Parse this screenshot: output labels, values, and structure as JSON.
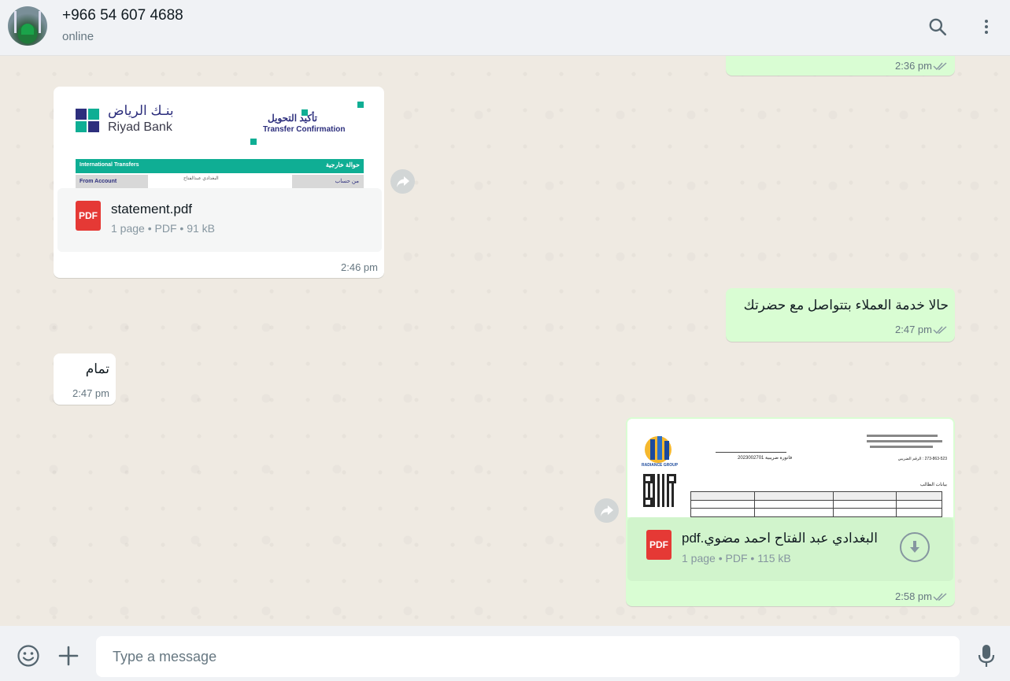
{
  "header": {
    "contact_name": "+966 54 607 4688",
    "status": "online",
    "icons": [
      "search-icon",
      "menu-dots-icon"
    ]
  },
  "messages": [
    {
      "id": "m0",
      "direction": "outgoing",
      "type": "partial",
      "time": "2:36 pm",
      "read": true
    },
    {
      "id": "m1",
      "direction": "incoming",
      "type": "document",
      "time": "2:46 pm",
      "file": {
        "name": "statement.pdf",
        "pages": "1 page",
        "kind": "PDF",
        "size": "91 kB"
      },
      "preview": {
        "bank_name_ar": "بنـك الرياض",
        "bank_name_en": "Riyad Bank",
        "title_ar": "تأكيد التحويل",
        "title_en": "Transfer Confirmation",
        "bar_left": "International Transfers",
        "bar_right": "حوالة خارجية",
        "row_left": "From Account",
        "row_mid": "البغدادي عبدالفتاح",
        "row_right": "من حساب"
      },
      "forward_icon": "forward-icon"
    },
    {
      "id": "m2",
      "direction": "outgoing",
      "type": "text",
      "text": "حالا خدمة العملاء بتتواصل مع حضرتك",
      "time": "2:47 pm",
      "read": true
    },
    {
      "id": "m3",
      "direction": "incoming",
      "type": "text",
      "text": "تمام",
      "time": "2:47 pm"
    },
    {
      "id": "m4",
      "direction": "outgoing",
      "type": "document",
      "time": "2:58 pm",
      "read": true,
      "file": {
        "name": "البغدادي عبد الفتاح احمد مضوي.pdf",
        "pages": "1 page",
        "kind": "PDF",
        "size": "115 kB"
      },
      "preview": {
        "logo_text": "RADIANCE GROUP",
        "top_right_line": "273-863-523 : الرقم الضريبي",
        "title_line": "فاتورة ضريبية 2023002701",
        "section_label": "بيانات الطالب"
      },
      "forward_icon": "forward-icon",
      "download_icon": "download-icon"
    }
  ],
  "footer": {
    "placeholder": "Type a message",
    "icons": [
      "emoji-icon",
      "attach-plus-icon",
      "mic-icon"
    ]
  },
  "colors": {
    "incoming_bubble": "#ffffff",
    "outgoing_bubble": "#d9fdd3",
    "read_ticks": "#8696a0",
    "pdf_red": "#e53935",
    "bank_teal": "#0fae94"
  }
}
